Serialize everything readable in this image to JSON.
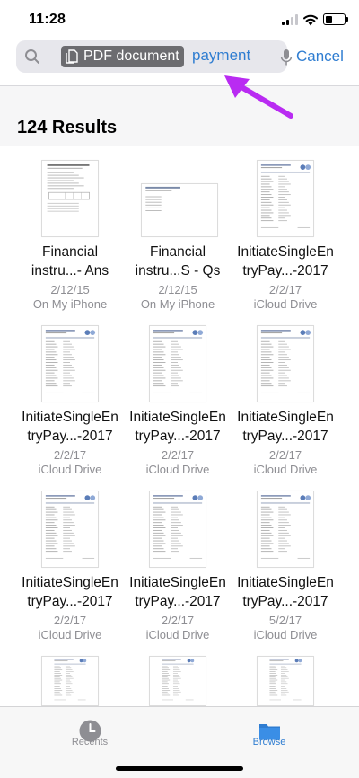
{
  "status_bar": {
    "time": "11:28",
    "battery_level": 0.35
  },
  "search": {
    "icon": "search-icon",
    "token_label": "PDF document",
    "token_icon": "document-icon",
    "query": "payment",
    "mic_icon": "mic-icon",
    "cancel_label": "Cancel"
  },
  "annotation": {
    "icon": "arrow-icon",
    "color": "#b92bf2"
  },
  "results": {
    "title": "124 Results",
    "items": [
      {
        "line1": "Financial",
        "line2": "instru...- Ans",
        "date": "2/12/15",
        "location": "On My iPhone",
        "thumb": "portrait-form"
      },
      {
        "line1": "Financial",
        "line2": "instru...S - Qs",
        "date": "2/12/15",
        "location": "On My iPhone",
        "thumb": "landscape"
      },
      {
        "line1": "InitiateSingleEn",
        "line2": "tryPay...-2017",
        "date": "2/2/17",
        "location": "iCloud Drive",
        "thumb": "portrait-doc"
      },
      {
        "line1": "InitiateSingleEn",
        "line2": "tryPay...-2017",
        "date": "2/2/17",
        "location": "iCloud Drive",
        "thumb": "portrait-doc"
      },
      {
        "line1": "InitiateSingleEn",
        "line2": "tryPay...-2017",
        "date": "2/2/17",
        "location": "iCloud Drive",
        "thumb": "portrait-doc"
      },
      {
        "line1": "InitiateSingleEn",
        "line2": "tryPay...-2017",
        "date": "2/2/17",
        "location": "iCloud Drive",
        "thumb": "portrait-doc"
      },
      {
        "line1": "InitiateSingleEn",
        "line2": "tryPay...-2017",
        "date": "2/2/17",
        "location": "iCloud Drive",
        "thumb": "portrait-doc"
      },
      {
        "line1": "InitiateSingleEn",
        "line2": "tryPay...-2017",
        "date": "2/2/17",
        "location": "iCloud Drive",
        "thumb": "portrait-doc"
      },
      {
        "line1": "InitiateSingleEn",
        "line2": "tryPay...-2017",
        "date": "5/2/17",
        "location": "iCloud Drive",
        "thumb": "portrait-doc"
      }
    ]
  },
  "tab_bar": {
    "tabs": [
      {
        "label": "Recents",
        "icon": "clock-icon",
        "active": false,
        "color": "#8e8e93"
      },
      {
        "label": "Browse",
        "icon": "folder-icon",
        "active": true,
        "color": "#2f7dd1"
      }
    ]
  }
}
